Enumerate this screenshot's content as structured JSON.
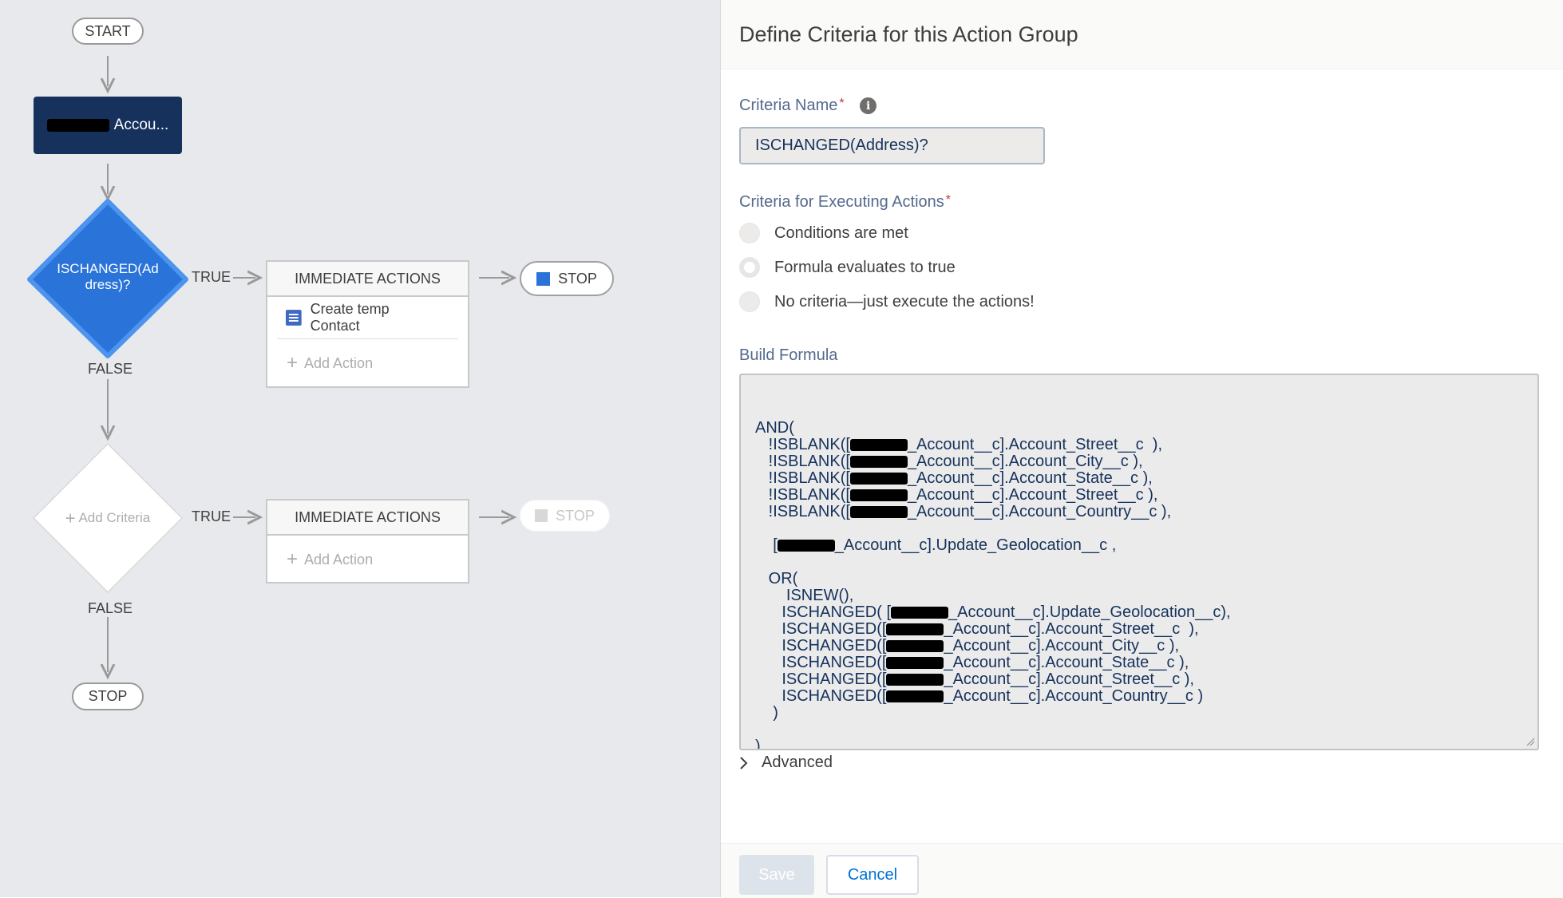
{
  "flow": {
    "start_label": "START",
    "object_node": {
      "label": "Accou..."
    },
    "criteria1": {
      "label": "ISCHANGED(Ad dress)?",
      "true_label": "TRUE",
      "false_label": "FALSE"
    },
    "actions1": {
      "header": "IMMEDIATE ACTIONS",
      "item_label": "Create temp Contact",
      "add_action": "Add Action"
    },
    "stop1": "STOP",
    "criteria2": {
      "label": "Add Criteria",
      "true_label": "TRUE",
      "false_label": "FALSE"
    },
    "actions2": {
      "header": "IMMEDIATE ACTIONS",
      "add_action": "Add Action"
    },
    "stop2": "STOP",
    "stop_end": "STOP"
  },
  "panel": {
    "title": "Define Criteria for this Action Group",
    "criteria_name_label": "Criteria Name",
    "criteria_name_value": "ISCHANGED(Address)?",
    "criteria_exec_label": "Criteria for Executing Actions",
    "options": [
      "Conditions are met",
      "Formula evaluates to true",
      "No criteria—just execute the actions!"
    ],
    "build_formula_label": "Build Formula",
    "formula_lines": [
      {
        "indent": "",
        "pre": "AND(",
        "post": ""
      },
      {
        "indent": "   ",
        "pre": "!ISBLANK([",
        "post": "_Account__c].Account_Street__c  ),"
      },
      {
        "indent": "   ",
        "pre": "!ISBLANK([",
        "post": "_Account__c].Account_City__c ),"
      },
      {
        "indent": "   ",
        "pre": "!ISBLANK([",
        "post": "_Account__c].Account_State__c ),"
      },
      {
        "indent": "   ",
        "pre": "!ISBLANK([",
        "post": "_Account__c].Account_Street__c ),"
      },
      {
        "indent": "   ",
        "pre": "!ISBLANK([",
        "post": "_Account__c].Account_Country__c ),"
      },
      {
        "indent": "",
        "pre": "",
        "post": ""
      },
      {
        "indent": "    ",
        "pre": "[",
        "post": "_Account__c].Update_Geolocation__c ,"
      },
      {
        "indent": "",
        "pre": "",
        "post": ""
      },
      {
        "indent": "   ",
        "pre": "OR(",
        "post": ""
      },
      {
        "indent": "       ",
        "pre": "ISNEW(),",
        "post": ""
      },
      {
        "indent": "      ",
        "pre": "ISCHANGED( [",
        "post": "_Account__c].Update_Geolocation__c),"
      },
      {
        "indent": "      ",
        "pre": "ISCHANGED([",
        "post": "_Account__c].Account_Street__c  ),"
      },
      {
        "indent": "      ",
        "pre": "ISCHANGED([",
        "post": "_Account__c].Account_City__c ),"
      },
      {
        "indent": "      ",
        "pre": "ISCHANGED([",
        "post": "_Account__c].Account_State__c ),"
      },
      {
        "indent": "      ",
        "pre": "ISCHANGED([",
        "post": "_Account__c].Account_Street__c ),"
      },
      {
        "indent": "      ",
        "pre": "ISCHANGED([",
        "post": "_Account__c].Account_Country__c )"
      },
      {
        "indent": "    ",
        "pre": ")",
        "post": ""
      },
      {
        "indent": "",
        "pre": "",
        "post": ""
      },
      {
        "indent": "",
        "pre": ")",
        "post": ""
      }
    ],
    "advanced_label": "Advanced",
    "save_label": "Save",
    "cancel_label": "Cancel"
  },
  "colors": {
    "canvas_bg": "#e8e9ec",
    "object_node": "#16325c",
    "active_diamond": "#2a73d9",
    "link_blue": "#0070d2"
  }
}
